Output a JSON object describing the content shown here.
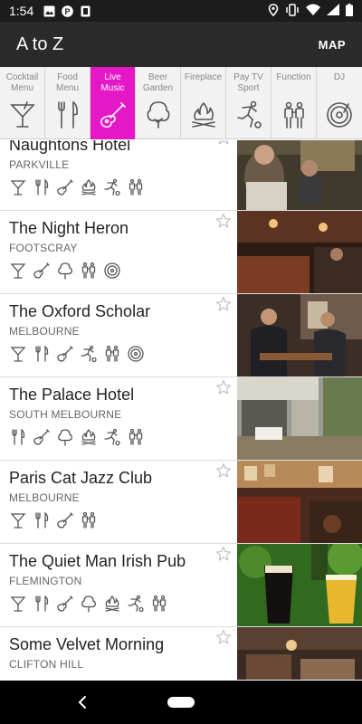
{
  "status": {
    "time": "1:54"
  },
  "appbar": {
    "title": "A to Z",
    "map_label": "MAP"
  },
  "filters": [
    {
      "label": "Cocktail\nMenu",
      "icon": "cocktail-icon",
      "active": false
    },
    {
      "label": "Food\nMenu",
      "icon": "fork-knife-icon",
      "active": false
    },
    {
      "label": "Live\nMusic",
      "icon": "guitar-icon",
      "active": true
    },
    {
      "label": "Beer\nGarden",
      "icon": "tree-icon",
      "active": false
    },
    {
      "label": "Fireplace",
      "icon": "fire-icon",
      "active": false
    },
    {
      "label": "Pay TV\nSport",
      "icon": "soccer-player-icon",
      "active": false
    },
    {
      "label": "Function",
      "icon": "people-icon",
      "active": false
    },
    {
      "label": "DJ",
      "icon": "vinyl-icon",
      "active": false
    }
  ],
  "venues": [
    {
      "name": "Naughtons Hotel",
      "suburb": "PARKVILLE",
      "amenities": [
        "cocktail",
        "food",
        "guitar",
        "fire",
        "soccer",
        "people"
      ]
    },
    {
      "name": "The Night Heron",
      "suburb": "FOOTSCRAY",
      "amenities": [
        "cocktail",
        "guitar",
        "tree",
        "people",
        "vinyl"
      ]
    },
    {
      "name": "The Oxford Scholar",
      "suburb": "MELBOURNE",
      "amenities": [
        "cocktail",
        "food",
        "guitar",
        "soccer",
        "people",
        "vinyl"
      ]
    },
    {
      "name": "The Palace Hotel",
      "suburb": "SOUTH MELBOURNE",
      "amenities": [
        "food",
        "guitar",
        "tree",
        "fire",
        "soccer",
        "people"
      ]
    },
    {
      "name": "Paris Cat Jazz Club",
      "suburb": "MELBOURNE",
      "amenities": [
        "cocktail",
        "food",
        "guitar",
        "people"
      ]
    },
    {
      "name": "The Quiet Man Irish Pub",
      "suburb": "FLEMINGTON",
      "amenities": [
        "cocktail",
        "food",
        "guitar",
        "tree",
        "fire",
        "soccer",
        "people"
      ]
    },
    {
      "name": "Some Velvet Morning",
      "suburb": "CLIFTON HILL",
      "amenities": []
    }
  ],
  "colors": {
    "accent": "#e617c7",
    "appbar": "#2b2b2b",
    "statusbar": "#1c1c1c"
  }
}
